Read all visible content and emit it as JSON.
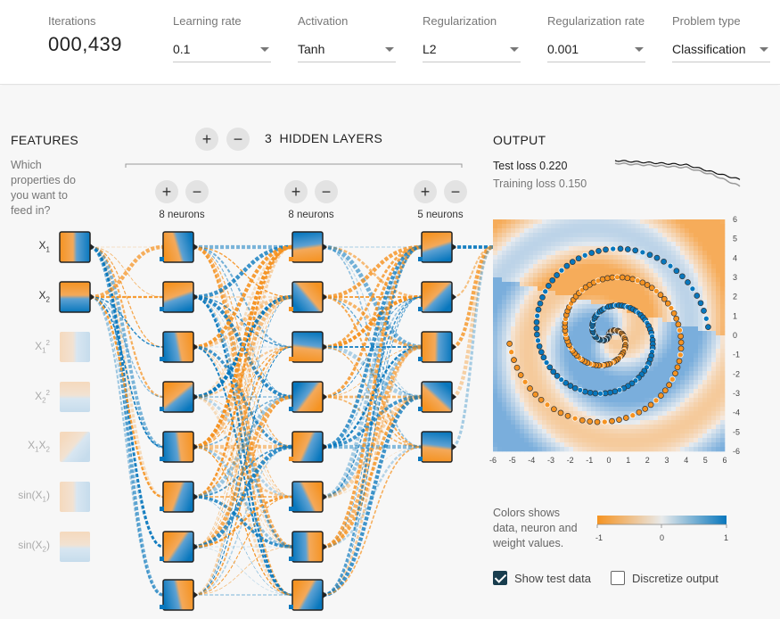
{
  "controls": {
    "iterations_label": "Iterations",
    "iterations_value": "000,439",
    "learning_rate": {
      "label": "Learning rate",
      "value": "0.1"
    },
    "activation": {
      "label": "Activation",
      "value": "Tanh"
    },
    "regularization": {
      "label": "Regularization",
      "value": "L2"
    },
    "regularization_rate": {
      "label": "Regularization rate",
      "value": "0.001"
    },
    "problem_type": {
      "label": "Problem type",
      "value": "Classification"
    }
  },
  "features": {
    "title": "FEATURES",
    "prompt": "Which properties do you want to feed in?",
    "items": [
      {
        "name": "x1",
        "base": "X",
        "sub": "1",
        "sup": "",
        "active": true
      },
      {
        "name": "x2",
        "base": "X",
        "sub": "2",
        "sup": "",
        "active": true
      },
      {
        "name": "x1-squared",
        "base": "X",
        "sub": "1",
        "sup": "2",
        "active": false
      },
      {
        "name": "x2-squared",
        "base": "X",
        "sub": "2",
        "sup": "2",
        "active": false
      },
      {
        "name": "x1x2",
        "base": "X",
        "sub": "1",
        "sup": "",
        "base2": "X",
        "sub2": "2",
        "active": false
      },
      {
        "name": "sin-x1",
        "text": "sin(X",
        "sub": "1",
        "tail": ")",
        "active": false
      },
      {
        "name": "sin-x2",
        "text": "sin(X",
        "sub": "2",
        "tail": ")",
        "active": false
      }
    ]
  },
  "hidden": {
    "count": "3",
    "title": "HIDDEN LAYERS",
    "plus": "+",
    "minus": "−",
    "layers": [
      {
        "neurons": 8,
        "label": "8 neurons"
      },
      {
        "neurons": 8,
        "label": "8 neurons"
      },
      {
        "neurons": 5,
        "label": "5 neurons"
      }
    ]
  },
  "output": {
    "title": "OUTPUT",
    "test_loss_label": "Test loss",
    "test_loss": "0.220",
    "training_loss_label": "Training loss",
    "training_loss": "0.150",
    "axis_ticks": [
      "-6",
      "-5",
      "-4",
      "-3",
      "-2",
      "-1",
      "0",
      "1",
      "2",
      "3",
      "4",
      "5",
      "6"
    ],
    "axis_ticks_y": [
      "6",
      "5",
      "4",
      "3",
      "2",
      "1",
      "0",
      "-1",
      "-2",
      "-3",
      "-4",
      "-5",
      "-6"
    ]
  },
  "legend": {
    "text": "Colors shows data, neuron and weight values.",
    "line1": "Colors shows",
    "line2": "data, neuron and",
    "line3": "weight values.",
    "min": "-1",
    "mid": "0",
    "max": "1"
  },
  "options": {
    "show_test_data": {
      "label": "Show test data",
      "checked": true
    },
    "discretize_output": {
      "label": "Discretize output",
      "checked": false
    }
  },
  "colors": {
    "orange": "#f59322",
    "blue": "#0877bd",
    "light_orange": "#f4b97c",
    "light_blue": "#78b0d9"
  }
}
